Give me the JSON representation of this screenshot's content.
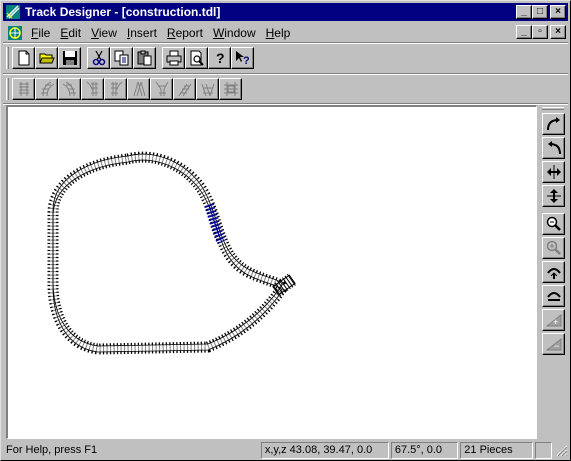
{
  "window": {
    "title": "Track Designer - [construction.tdl]",
    "title_bar_color": "#000080",
    "controls": {
      "minimize": "_",
      "maximize": "□",
      "close": "×"
    }
  },
  "menu": {
    "items": [
      {
        "label": "File",
        "accel": "F"
      },
      {
        "label": "Edit",
        "accel": "E"
      },
      {
        "label": "View",
        "accel": "V"
      },
      {
        "label": "Insert",
        "accel": "I"
      },
      {
        "label": "Report",
        "accel": "R"
      },
      {
        "label": "Window",
        "accel": "W"
      },
      {
        "label": "Help",
        "accel": "H"
      }
    ]
  },
  "toolbar_main": {
    "buttons": [
      "new-document-icon",
      "open-folder-icon",
      "save-disk-icon",
      "cut-scissors-icon",
      "copy-icon",
      "paste-icon",
      "print-icon",
      "print-preview-icon",
      "help-question-icon",
      "context-help-icon"
    ]
  },
  "toolbar_track": {
    "buttons": [
      "straight-track-icon",
      "curve-left-track-icon",
      "curve-right-track-icon",
      "switch-left-track-icon",
      "switch-right-track-icon",
      "crossing-track-icon",
      "wye-track-icon",
      "ramp-up-track-icon",
      "ramp-down-track-icon",
      "bridge-track-icon"
    ]
  },
  "right_toolbar": {
    "buttons": [
      "rotate-cw-icon",
      "rotate-ccw-icon",
      "flip-horizontal-icon",
      "flip-vertical-icon",
      "zoom-out-icon",
      "zoom-in-icon",
      "raise-icon",
      "lower-icon",
      "elevation-up-icon",
      "elevation-down-icon"
    ]
  },
  "status": {
    "help": "For Help, press F1",
    "coords": "x,y,z 43.08, 39.47, 0.0",
    "angle": "67.5°, 0.0",
    "pieces": "21 Pieces"
  },
  "colors": {
    "track": "#000000",
    "selected_track": "#0000a0",
    "canvas": "#ffffff",
    "face": "#c0c0c0"
  }
}
